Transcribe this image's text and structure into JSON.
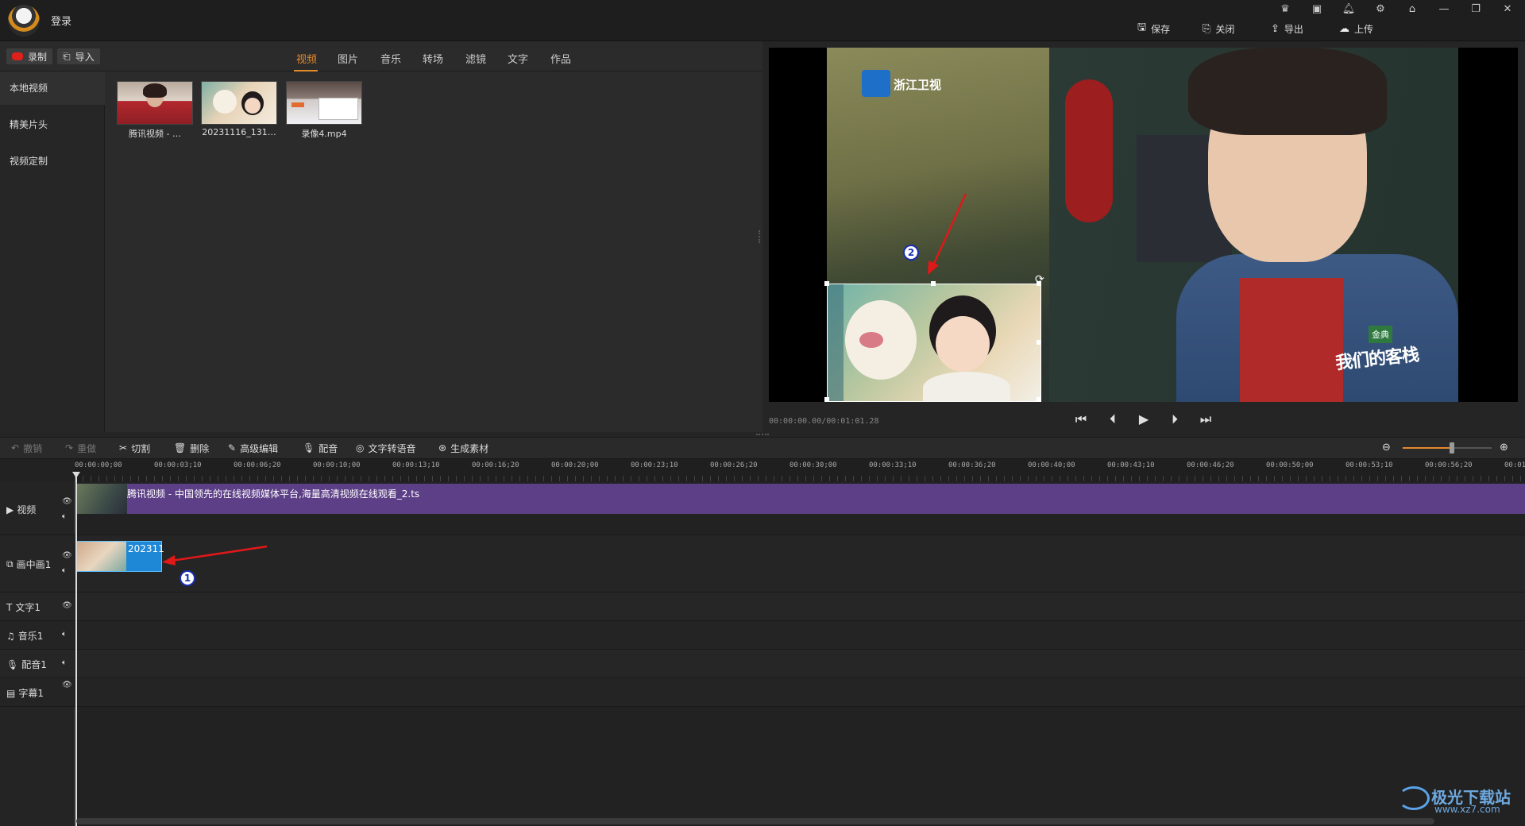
{
  "titlebar": {
    "login": "登录",
    "buttons": [
      {
        "label": "保存",
        "icon": "save-icon"
      },
      {
        "label": "关闭",
        "icon": "close-doc-icon"
      },
      {
        "label": "导出",
        "icon": "export-icon"
      },
      {
        "label": "上传",
        "icon": "upload-icon"
      }
    ],
    "vip_badge": "VIP"
  },
  "media": {
    "record_label": "录制",
    "import_label": "导入",
    "tabs": [
      "视频",
      "图片",
      "音乐",
      "转场",
      "滤镜",
      "文字",
      "作品"
    ],
    "active_tab": "视频",
    "sidebar": [
      "本地视频",
      "精美片头",
      "视频定制"
    ],
    "thumbnails": [
      {
        "caption": "腾讯视频 - …"
      },
      {
        "caption": "20231116_131…"
      },
      {
        "caption": "录像4.mp4"
      }
    ]
  },
  "preview": {
    "timecode": "00:00:00.00/00:01:01.28",
    "overlay_logo": "浙江卫视",
    "overlay_show": "我们的客栈",
    "overlay_badge": "金典"
  },
  "edit_toolbar": {
    "items": [
      {
        "label": "撤销",
        "icon": "undo-icon",
        "enabled": false
      },
      {
        "label": "重做",
        "icon": "redo-icon",
        "enabled": false
      },
      {
        "label": "切割",
        "icon": "scissors-icon",
        "enabled": true
      },
      {
        "label": "删除",
        "icon": "trash-icon",
        "enabled": true
      },
      {
        "label": "高级编辑",
        "icon": "pencil-icon",
        "enabled": true
      },
      {
        "label": "配音",
        "icon": "microphone-icon",
        "enabled": true
      },
      {
        "label": "文字转语音",
        "icon": "tts-icon",
        "enabled": true
      },
      {
        "label": "生成素材",
        "icon": "generate-icon",
        "enabled": true
      }
    ],
    "zoom_level": 0.55
  },
  "timeline": {
    "ticks": [
      "00:00:00;00",
      "00:00:03;10",
      "00:00:06;20",
      "00:00:10;00",
      "00:00:13;10",
      "00:00:16;20",
      "00:00:20;00",
      "00:00:23;10",
      "00:00:26;20",
      "00:00:30;00",
      "00:00:33;10",
      "00:00:36;20",
      "00:00:40;00",
      "00:00:43;10",
      "00:00:46;20",
      "00:00:50;00",
      "00:00:53;10",
      "00:00:56;20",
      "00:01"
    ],
    "tracks": [
      {
        "label": "视频",
        "icon": "play-square-icon"
      },
      {
        "label": "画中画1",
        "icon": "pip-icon"
      },
      {
        "label": "文字1",
        "icon": "text-icon"
      },
      {
        "label": "音乐1",
        "icon": "music-icon"
      },
      {
        "label": "配音1",
        "icon": "microphone-icon"
      },
      {
        "label": "字幕1",
        "icon": "subtitle-icon"
      }
    ],
    "video_clip": "腾讯视频 - 中国领先的在线视频媒体平台,海量高清视频在线观看_2.ts",
    "pip_clip": "202311"
  },
  "annotations": [
    "1",
    "2"
  ],
  "watermark": {
    "title": "极光下载站",
    "url": "www.xz7.com"
  },
  "colors": {
    "accent": "#e58a2c",
    "video_clip": "#5c3f86",
    "pip_clip": "#1e88d7",
    "record": "#e0201a"
  }
}
